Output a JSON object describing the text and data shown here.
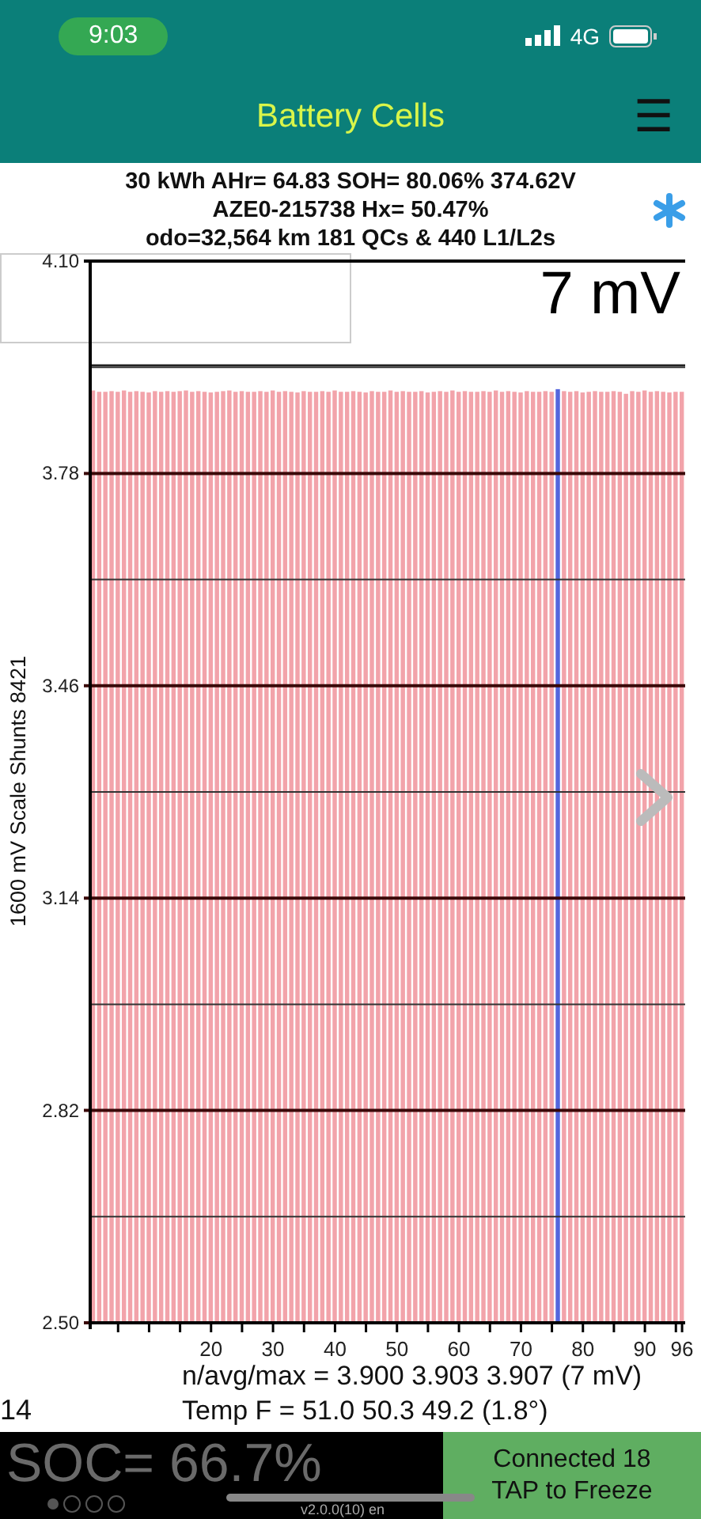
{
  "status_bar": {
    "time": "9:03",
    "network": "4G"
  },
  "header": {
    "title": "Battery Cells",
    "menu_icon": "☰"
  },
  "summary": {
    "lines": [
      "30 kWh  AHr= 64.83  SOH= 80.06%    374.62V",
      "AZE0-215738   Hx= 50.47%",
      "odo=32,564 km 181 QCs & 440 L1/L2s"
    ]
  },
  "chart": {
    "spread": "7 mV",
    "chart_data": {
      "type": "bar",
      "ylabel": "1600 mV Scale   Shunts 8421",
      "ylim": [
        2.5,
        4.1
      ],
      "grid": true,
      "x": [
        1,
        2,
        3,
        4,
        5,
        6,
        7,
        8,
        9,
        10,
        11,
        12,
        13,
        14,
        15,
        16,
        17,
        18,
        19,
        20,
        21,
        22,
        23,
        24,
        25,
        26,
        27,
        28,
        29,
        30,
        31,
        32,
        33,
        34,
        35,
        36,
        37,
        38,
        39,
        40,
        41,
        42,
        43,
        44,
        45,
        46,
        47,
        48,
        49,
        50,
        51,
        52,
        53,
        54,
        55,
        56,
        57,
        58,
        59,
        60,
        61,
        62,
        63,
        64,
        65,
        66,
        67,
        68,
        69,
        70,
        71,
        72,
        73,
        74,
        75,
        76,
        77,
        78,
        79,
        80,
        81,
        82,
        83,
        84,
        85,
        86,
        87,
        88,
        89,
        90,
        91,
        92,
        93,
        94,
        95,
        96
      ],
      "yticks": [
        {
          "value": 4.1,
          "label": "4.10"
        },
        3.78,
        3.46,
        3.14,
        2.82,
        {
          "value": 2.5,
          "label": "2.50"
        }
      ],
      "xlim": [
        1,
        96
      ],
      "xticks": [
        20,
        30,
        40,
        50,
        60,
        70,
        80,
        90,
        96
      ],
      "series": [
        {
          "color": "#f2a3aa",
          "values": [
            3.905,
            3.903,
            3.903,
            3.904,
            3.903,
            3.905,
            3.903,
            3.904,
            3.903,
            3.902,
            3.904,
            3.903,
            3.904,
            3.903,
            3.904,
            3.905,
            3.903,
            3.904,
            3.903,
            3.902,
            3.903,
            3.904,
            3.905,
            3.903,
            3.904,
            3.903,
            3.903,
            3.904,
            3.903,
            3.905,
            3.903,
            3.904,
            3.903,
            3.902,
            3.904,
            3.903,
            3.903,
            3.904,
            3.903,
            3.905,
            3.903,
            3.903,
            3.904,
            3.903,
            3.902,
            3.904,
            3.903,
            3.903,
            3.905,
            3.903,
            3.904,
            3.903,
            3.903,
            3.904,
            3.902,
            3.903,
            3.904,
            3.903,
            3.905,
            3.903,
            3.904,
            3.903,
            3.903,
            3.904,
            3.903,
            3.905,
            3.903,
            3.904,
            3.903,
            3.902,
            3.904,
            3.903,
            3.903,
            3.904,
            3.903,
            null,
            3.904,
            3.903,
            3.904,
            3.902,
            3.903,
            3.904,
            3.903,
            3.903,
            3.904,
            3.903,
            3.9,
            3.904,
            3.903,
            3.905,
            3.903,
            3.904,
            3.903,
            3.902,
            3.903,
            3.903
          ]
        },
        {
          "color": "#5566dd",
          "values": [
            null,
            null,
            null,
            null,
            null,
            null,
            null,
            null,
            null,
            null,
            null,
            null,
            null,
            null,
            null,
            null,
            null,
            null,
            null,
            null,
            null,
            null,
            null,
            null,
            null,
            null,
            null,
            null,
            null,
            null,
            null,
            null,
            null,
            null,
            null,
            null,
            null,
            null,
            null,
            null,
            null,
            null,
            null,
            null,
            null,
            null,
            null,
            null,
            null,
            null,
            null,
            null,
            null,
            null,
            null,
            null,
            null,
            null,
            null,
            null,
            null,
            null,
            null,
            null,
            null,
            null,
            null,
            null,
            null,
            null,
            null,
            null,
            null,
            null,
            null,
            3.907,
            null,
            null,
            null,
            null,
            null,
            null,
            null,
            null,
            null,
            null,
            null,
            null,
            null,
            null,
            null,
            null,
            null,
            null,
            null,
            null
          ]
        }
      ],
      "ref_lines": [
        {
          "axis": "y",
          "value": 3.943
        }
      ]
    }
  },
  "stats": [
    "n/avg/max = 3.900 3.903 3.907  (7 mV)",
    "Temp F = 51.0  50.3  49.2  (1.8°)"
  ],
  "time_fragment": "14",
  "soc": "SOC= 66.7%",
  "pages": [
    {
      "selected": true
    },
    {
      "selected": false
    },
    {
      "selected": false
    },
    {
      "selected": false
    }
  ],
  "version": "v2.0.0(10) en",
  "connect_button": {
    "lines": [
      "Connected 18",
      "TAP to Freeze"
    ]
  }
}
